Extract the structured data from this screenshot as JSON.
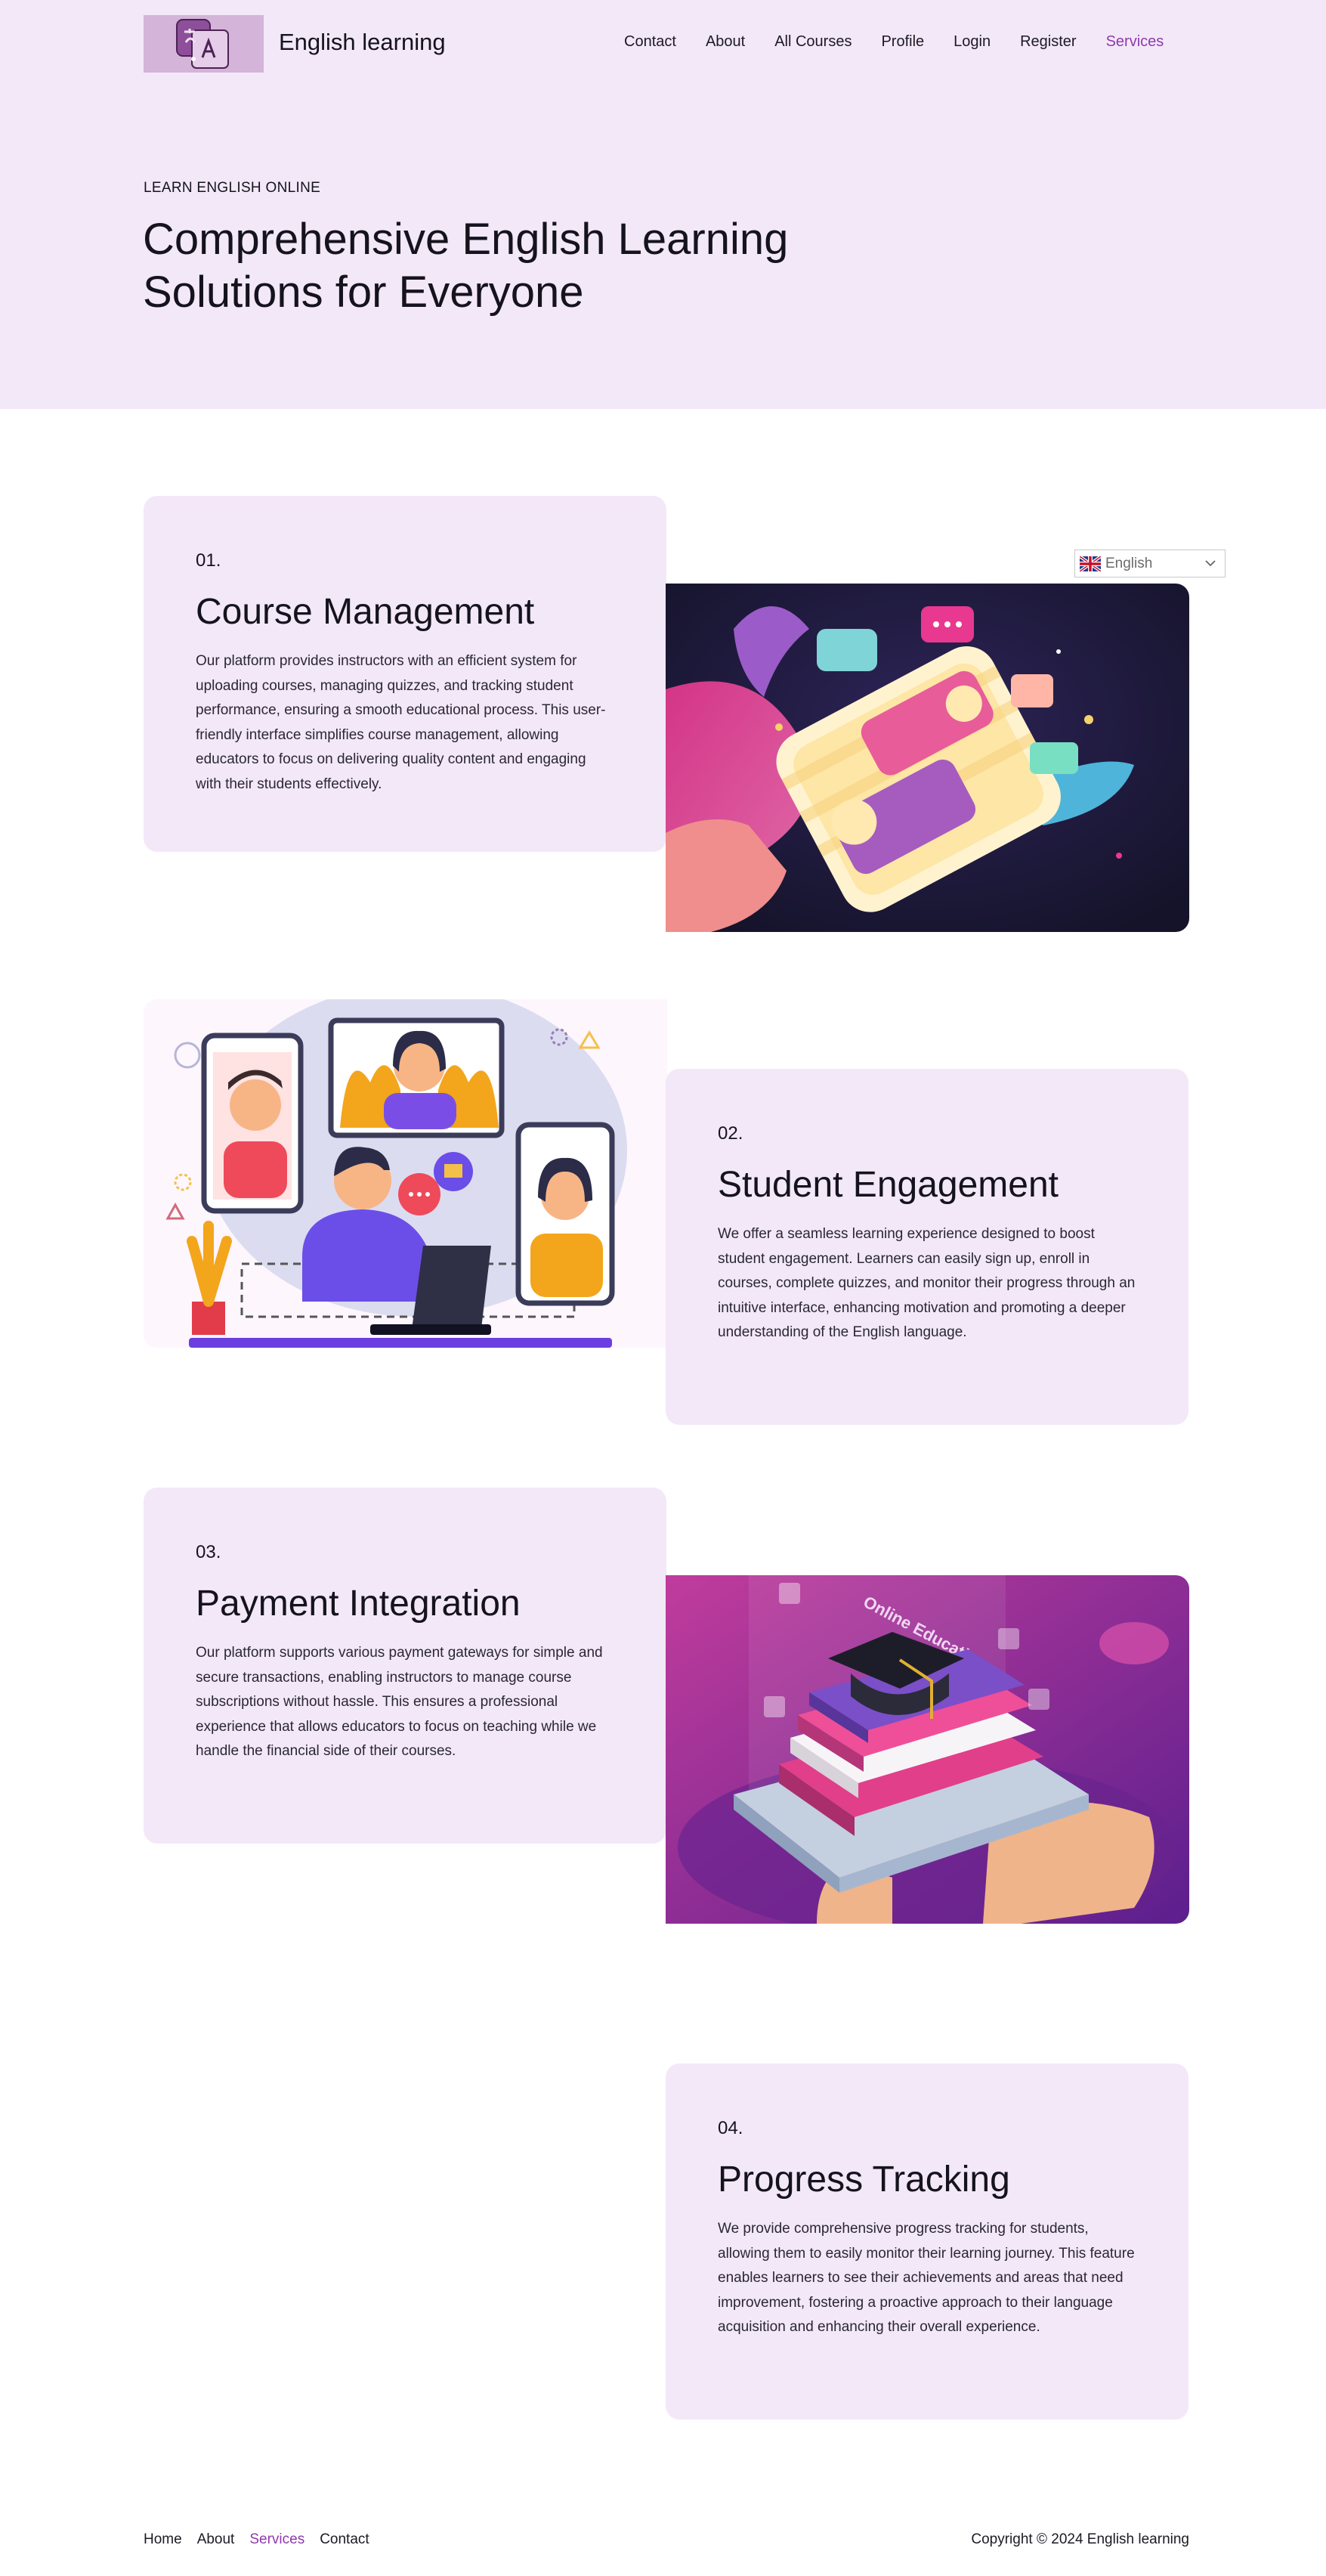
{
  "header": {
    "site_title": "English learning",
    "nav": [
      {
        "label": "Contact"
      },
      {
        "label": "About"
      },
      {
        "label": "All Courses"
      },
      {
        "label": "Profile"
      },
      {
        "label": "Login"
      },
      {
        "label": "Register"
      },
      {
        "label": "Services",
        "active": true
      }
    ],
    "logo_icon": "translate-icon"
  },
  "hero": {
    "eyebrow": "LEARN ENGLISH ONLINE",
    "heading": "Comprehensive English Learning Solutions for Everyone"
  },
  "features": [
    {
      "number": "01.",
      "title": "Course Management",
      "description": "Our platform provides instructors with an efficient system for uploading courses, managing quizzes, and tracking student performance, ensuring a smooth educational process. This user-friendly interface simplifies course management, allowing educators to focus on delivering quality content and engaging with their students effectively.",
      "illustration": "phone-chat-illustration"
    },
    {
      "number": "02.",
      "title": "Student Engagement",
      "description": "We offer a seamless learning experience designed to boost student engagement. Learners can easily sign up, enroll in courses, complete quizzes, and monitor their progress through an intuitive interface, enhancing motivation and promoting a deeper understanding of the English language.",
      "illustration": "video-call-illustration"
    },
    {
      "number": "03.",
      "title": "Payment Integration",
      "description": "Our platform supports various payment gateways for simple and secure transactions, enabling instructors to manage course subscriptions without hassle. This ensures a professional experience that allows educators to focus on teaching while we handle the financial side of their courses.",
      "illustration": "online-education-illustration",
      "illustration_caption": "Online Education"
    },
    {
      "number": "04.",
      "title": "Progress Tracking",
      "description": "We provide comprehensive progress tracking for students, allowing them to easily monitor their learning journey. This feature enables learners to see their achievements and areas that need improvement, fostering a proactive approach to their language acquisition and enhancing their overall experience."
    }
  ],
  "language_selector": {
    "value": "English",
    "flag_icon": "uk-flag-icon",
    "chevron_icon": "chevron-down-icon"
  },
  "footer": {
    "links": [
      {
        "label": "Home"
      },
      {
        "label": "About"
      },
      {
        "label": "Services",
        "active": true
      },
      {
        "label": "Contact"
      }
    ],
    "copyright": "Copyright © 2024 English learning"
  },
  "colors": {
    "hero_bg": "#f3e8f8",
    "card_bg": "#f3e8f8",
    "accent": "#8f3aad",
    "text": "#15131d"
  }
}
